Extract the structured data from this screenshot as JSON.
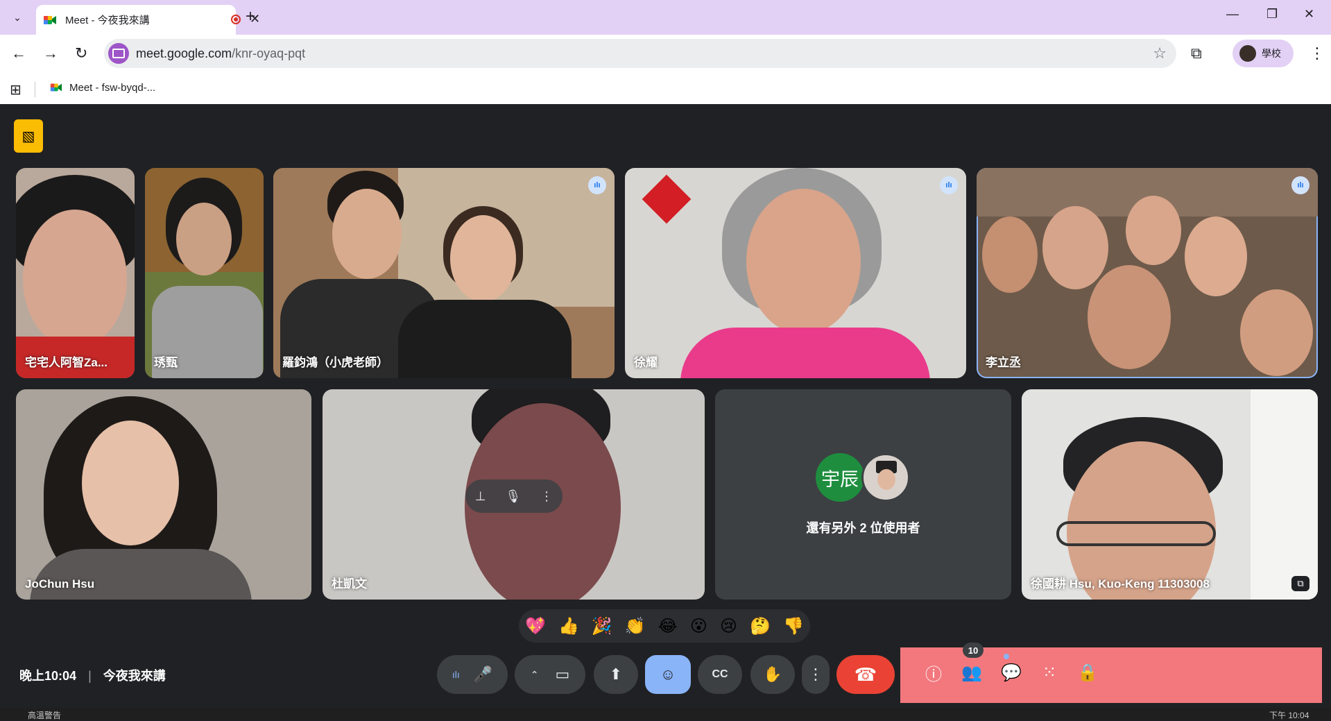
{
  "browser": {
    "tab_title": "Meet - 今夜我來講",
    "url_host": "meet.google.com",
    "url_path": "/knr-oyaq-pqt",
    "profile_name": "學校",
    "bookmark": "Meet - fsw-byqd-..."
  },
  "meeting": {
    "time": "晚上10:04",
    "title": "今夜我來講",
    "participants_count": "10",
    "others_label": "還有另外 2 位使用者",
    "others_avatar_text": "宇辰"
  },
  "tiles": [
    {
      "name": "宅宅人阿智Za..."
    },
    {
      "name": "琇甄"
    },
    {
      "name": "羅鈞鴻（小虎老師）"
    },
    {
      "name": "徐耀"
    },
    {
      "name": "李立丞"
    },
    {
      "name": "JoChun Hsu"
    },
    {
      "name": "杜凱文"
    },
    {
      "name": "徐國耕 Hsu, Kuo-Keng 11303008"
    }
  ],
  "reactions": [
    "💖",
    "👍",
    "🎉",
    "👏",
    "😂",
    "😮",
    "😢",
    "🤔",
    "👎"
  ],
  "taskbar": {
    "left": "高溫警告",
    "right": "下午 10:04"
  },
  "colors": {
    "accent": "#8ab4f8",
    "end_call": "#ea4335",
    "panel": "#f2787d",
    "tab_strip": "#e3d0f5"
  }
}
